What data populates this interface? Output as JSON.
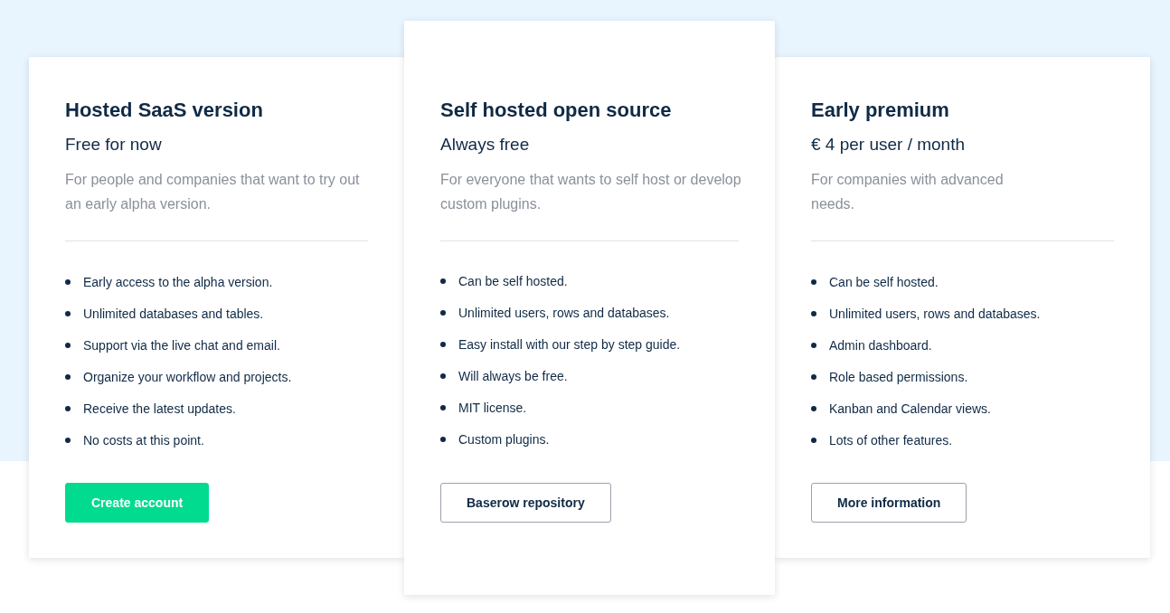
{
  "plans": [
    {
      "title": "Hosted SaaS version",
      "price": "Free for now",
      "description": "For people and companies that want to try out an early alpha version.",
      "features": [
        "Early access to the alpha version.",
        "Unlimited databases and tables.",
        "Support via the live chat and email.",
        "Organize your workflow and projects.",
        "Receive the latest updates.",
        "No costs at this point."
      ],
      "button": {
        "label": "Create account",
        "kind": "primary"
      },
      "featured": false
    },
    {
      "title": "Self hosted open source",
      "price": "Always free",
      "description": "For everyone that wants to self host or develop custom plugins.",
      "features": [
        "Can be self hosted.",
        "Unlimited users, rows and databases.",
        "Easy install with our step by step guide.",
        "Will always be free.",
        "MIT license.",
        "Custom plugins."
      ],
      "button": {
        "label": "Baserow repository",
        "kind": "outline"
      },
      "featured": true
    },
    {
      "title": "Early premium",
      "price": "€ 4 per user / month",
      "description": "For companies with advanced needs.",
      "features": [
        "Can be self hosted.",
        "Unlimited users, rows and databases.",
        "Admin dashboard.",
        "Role based permissions.",
        "Kanban and Calendar views.",
        "Lots of other features."
      ],
      "button": {
        "label": "More information",
        "kind": "outline"
      },
      "featured": false
    }
  ]
}
